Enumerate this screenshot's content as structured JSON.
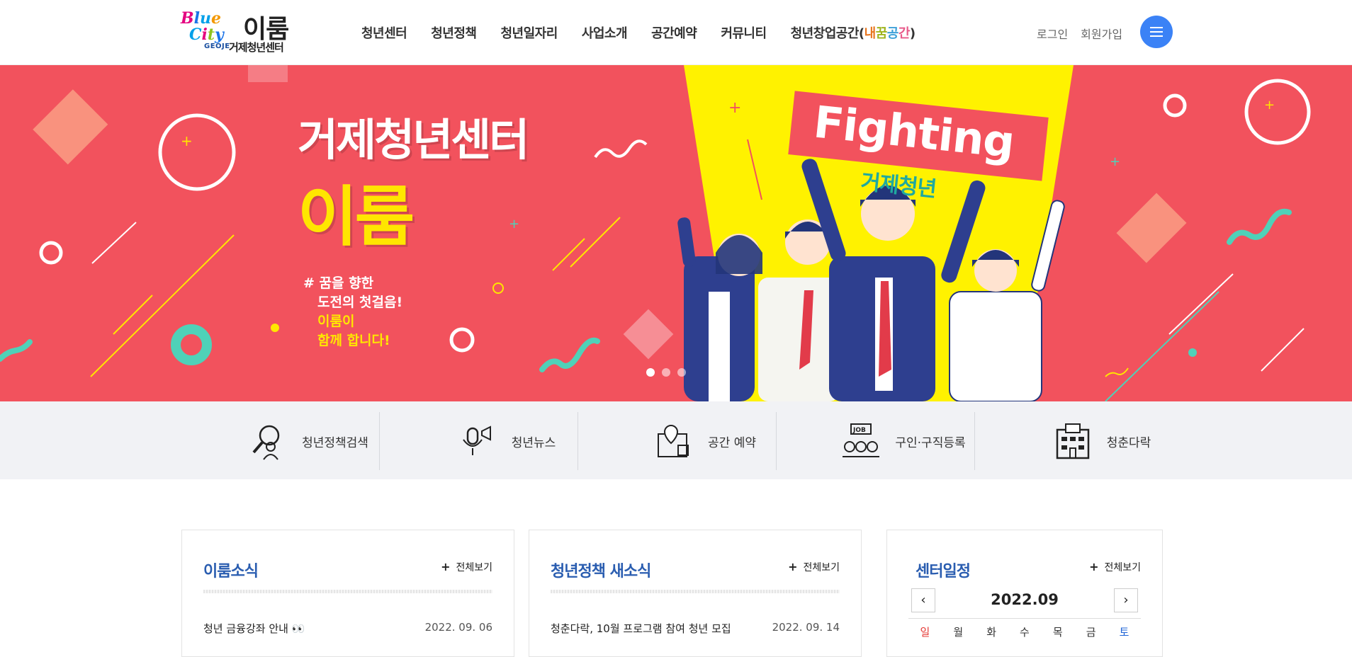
{
  "header": {
    "logo": {
      "blue": "Blue",
      "city": "City",
      "geoje": "GEOJE",
      "name": "이룸",
      "sub": "거제청년센터"
    },
    "nav": [
      {
        "label": "청년센터"
      },
      {
        "label": "청년정책"
      },
      {
        "label": "청년일자리"
      },
      {
        "label": "사업소개"
      },
      {
        "label": "공간예약"
      },
      {
        "label": "커뮤니티"
      }
    ],
    "nav_last": {
      "prefix": "청년창업공간(",
      "h1": "내",
      "h2": "꿈",
      "h3": "공",
      "h4": "간",
      "suffix": ")"
    },
    "login": "로그인",
    "signup": "회원가입",
    "menu_icon": "hamburger-icon"
  },
  "banner": {
    "headline1": "거제청년센터",
    "headline2": "이룸",
    "slogan_line1": "# 꿈을 향한",
    "slogan_line2": "도전의 첫걸음!",
    "slogan_line3": "이룸이",
    "slogan_line4": "함께 합니다!",
    "fighting": "Fighting",
    "fighting_sub": "거제청년",
    "slides": 3,
    "active_slide": 1
  },
  "quick": [
    {
      "label": "청년정책검색",
      "icon": "magnifier-person-icon"
    },
    {
      "label": "청년뉴스",
      "icon": "microphone-megaphone-icon"
    },
    {
      "label": "공간 예약",
      "icon": "map-location-icon"
    },
    {
      "label": "구인·구직등록",
      "icon": "job-people-icon"
    },
    {
      "label": "청춘다락",
      "icon": "building-icon"
    }
  ],
  "boards": {
    "news": {
      "title": "이룸소식",
      "more": "전체보기",
      "item_title": "청년 금융강좌 안내 👀",
      "item_date": "2022. 09. 06"
    },
    "policy": {
      "title": "청년정책 새소식",
      "more": "전체보기",
      "item_title": "청춘다락, 10월 프로그램 참여 청년 모집",
      "item_date": "2022. 09. 14"
    },
    "schedule": {
      "title": "센터일정",
      "more": "전체보기",
      "month": "2022.09",
      "prev": "‹",
      "next": "›",
      "days": [
        "일",
        "월",
        "화",
        "수",
        "목",
        "금",
        "토"
      ]
    }
  },
  "colors": {
    "banner_bg": "#f2525d",
    "accent_yellow": "#ffe600",
    "title_blue": "#2a5db0",
    "menu_btn": "#3b82f6"
  }
}
